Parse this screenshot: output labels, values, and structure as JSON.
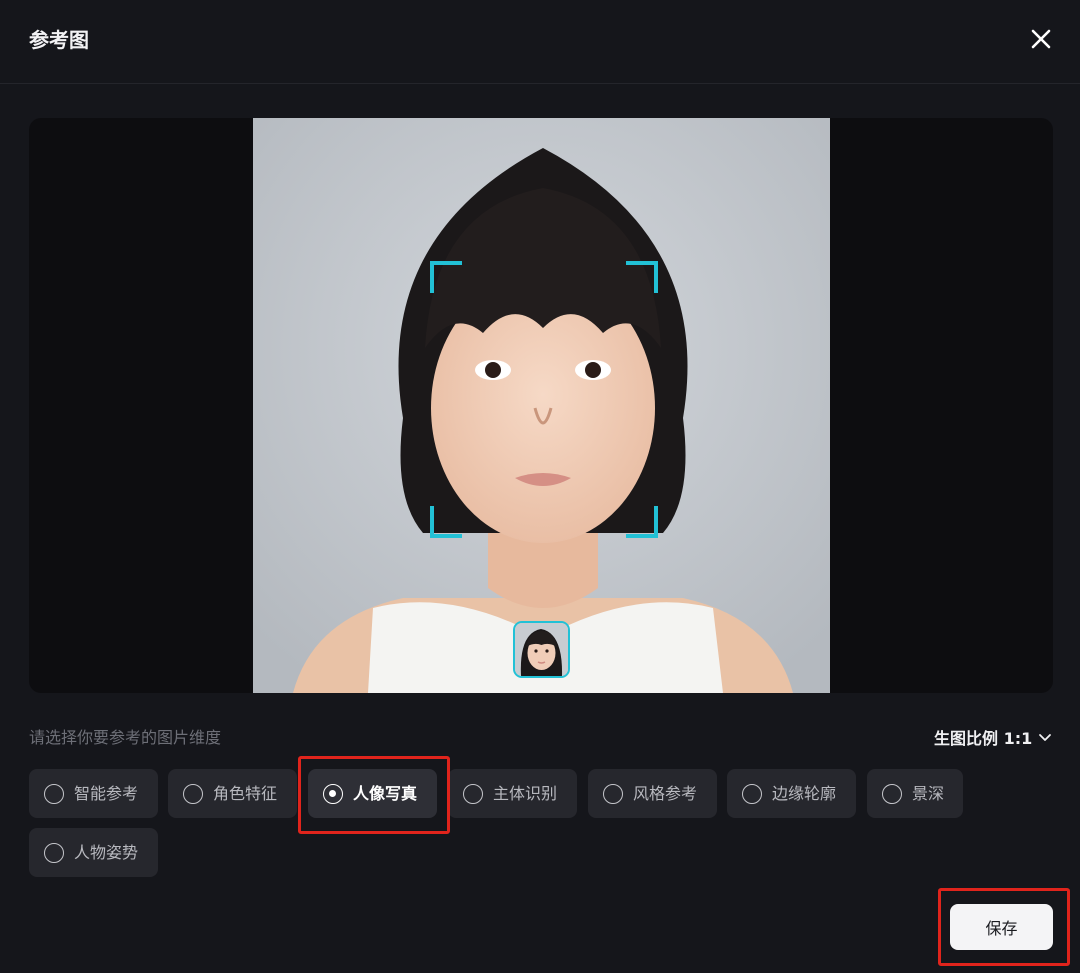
{
  "dialog": {
    "title": "参考图",
    "close_icon": "close-icon"
  },
  "preview": {
    "image": "portrait-photo",
    "face_box_color": "#22c1d6"
  },
  "dimensions": {
    "prompt": "请选择你要参考的图片维度",
    "ratio_label": "生图比例 1:1",
    "options": [
      {
        "label": "智能参考",
        "selected": false
      },
      {
        "label": "角色特征",
        "selected": false
      },
      {
        "label": "人像写真",
        "selected": true
      },
      {
        "label": "主体识别",
        "selected": false
      },
      {
        "label": "风格参考",
        "selected": false
      },
      {
        "label": "边缘轮廓",
        "selected": false
      },
      {
        "label": "景深",
        "selected": false
      },
      {
        "label": "人物姿势",
        "selected": false
      }
    ]
  },
  "footer": {
    "save_label": "保存"
  },
  "colors": {
    "background": "#15161b",
    "accent": "#22c1d6",
    "annotation": "#e0241c"
  }
}
